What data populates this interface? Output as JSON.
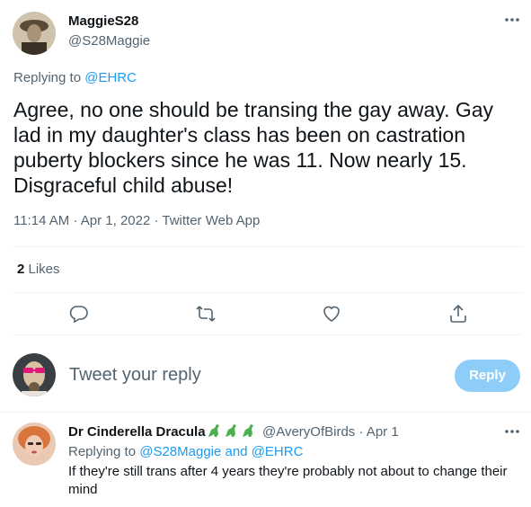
{
  "tweet": {
    "author_name": "MaggieS28",
    "author_handle": "@S28Maggie",
    "replying_prefix": "Replying to ",
    "replying_to": "@EHRC",
    "text": "Agree, no one should be transing the gay away. Gay lad in my daughter's class has been on castration puberty blockers since he was 11. Now nearly 15. Disgraceful child abuse!",
    "meta": "11:14 AM · Apr 1, 2022 · Twitter Web App",
    "likes_count": "2",
    "likes_label": " Likes"
  },
  "actions": {
    "icons": [
      "reply-icon",
      "retweet-icon",
      "like-icon",
      "share-icon"
    ]
  },
  "composer": {
    "placeholder": "Tweet your reply",
    "reply_button": "Reply"
  },
  "reply": {
    "author_name": "Dr Cinderella Dracula",
    "author_emoji": "🦕🦕🦕",
    "author_handle": "@AveryOfBirds · Apr 1",
    "replying_prefix": "Replying to ",
    "replying_to": "@S28Maggie and @EHRC",
    "text": "If they're still trans after 4 years they're probably not about to change their mind"
  },
  "colors": {
    "accent": "#1d9bf0",
    "muted": "#536471",
    "reply_button_disabled": "#8ecdf8",
    "divider": "#eff3f4"
  }
}
